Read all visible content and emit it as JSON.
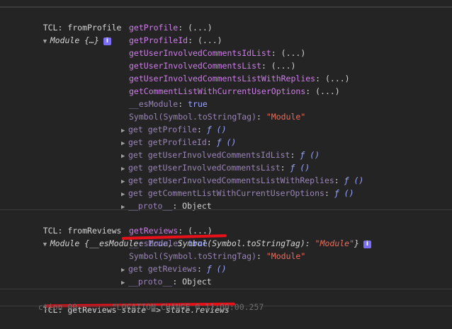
{
  "log1": {
    "label": "TCL: fromProfile",
    "summary": "Module {…}",
    "props": [
      {
        "key": "getProfile",
        "val": "(...)"
      },
      {
        "key": "getProfileId",
        "val": "(...)"
      },
      {
        "key": "getUserInvolvedCommentsIdList",
        "val": "(...)"
      },
      {
        "key": "getUserInvolvedCommentsList",
        "val": "(...)"
      },
      {
        "key": "getUserInvolvedCommentsListWithReplies",
        "val": "(...)"
      },
      {
        "key": "getCommentListWithCurrentUserOptions",
        "val": "(...)"
      }
    ],
    "esmodule_key": "__esModule",
    "esmodule_val": "true",
    "symbol_key": "Symbol(Symbol.toStringTag)",
    "symbol_val": "\"Module\"",
    "getters": [
      "get getProfile",
      "get getProfileId",
      "get getUserInvolvedCommentsIdList",
      "get getUserInvolvedCommentsList",
      "get getUserInvolvedCommentsListWithReplies",
      "get getCommentListWithCurrentUserOptions"
    ],
    "getter_val": "ƒ ()",
    "proto_key": "__proto__",
    "proto_val": "Object"
  },
  "log2": {
    "label": "TCL: fromReviews",
    "summary_pre": "Module {",
    "summary_key1": "__esModule",
    "summary_val1": "true",
    "summary_key2": "Symbol(Symbol.toStringTag)",
    "summary_val2": "\"Module\"",
    "summary_post": "}",
    "prop_key": "getReviews",
    "prop_val": "(...)",
    "esmodule_key": "__esModule",
    "esmodule_val": "true",
    "symbol_key": "Symbol(Symbol.toStringTag)",
    "symbol_val": "\"Module\"",
    "getter": "get getReviews",
    "getter_val": "ƒ ()",
    "proto_key": "__proto__",
    "proto_val": "Object"
  },
  "log3": {
    "label": "TCL:",
    "name": "getReviews",
    "value": "state => state.reviews"
  },
  "log4": {
    "text": "  ction 00  ...  \"LOCATION_CHANGE 0 11:00:00.257"
  },
  "colors": {
    "background": "#242424",
    "property": "#cc7ee6",
    "keyword": "#9ba6ff",
    "string": "#ef6b5b",
    "annotation": "#e8111a"
  }
}
